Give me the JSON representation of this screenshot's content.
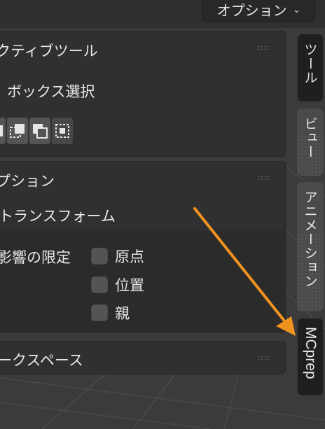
{
  "header": {
    "options_label": "オプション",
    "options_icon": "chevron-down-icon"
  },
  "active_tool_panel": {
    "title": "クティブツール",
    "tool_name": "ボックス選択",
    "grip": "::::"
  },
  "options_panel": {
    "title": "プション",
    "transform_label": "トランスフォーム",
    "affect_only_label": "影響の限定",
    "checks": [
      {
        "label": "原点",
        "checked": false
      },
      {
        "label": "位置",
        "checked": false
      },
      {
        "label": "親",
        "checked": false
      }
    ],
    "grip": "::::"
  },
  "workspace_panel": {
    "title": "ークスペース",
    "grip": "::::"
  },
  "tabs": [
    {
      "label": "ツール",
      "active": true
    },
    {
      "label": "ビュー",
      "active": false
    },
    {
      "label": "アニメーション",
      "active": false
    },
    {
      "label": "MCprep",
      "active": true
    }
  ],
  "annotation": {
    "arrow_color": "#f0931e"
  }
}
